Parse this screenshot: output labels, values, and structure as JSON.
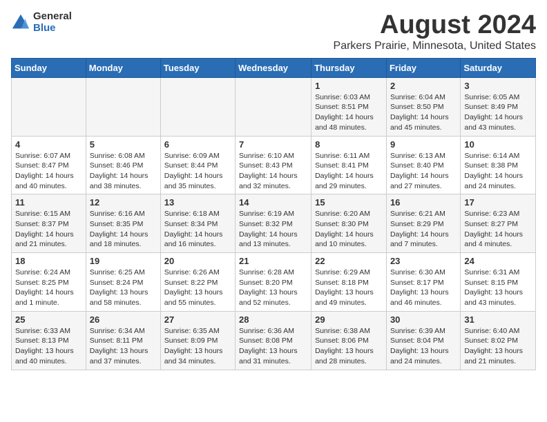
{
  "header": {
    "logo_general": "General",
    "logo_blue": "Blue",
    "month_year": "August 2024",
    "location": "Parkers Prairie, Minnesota, United States"
  },
  "days_of_week": [
    "Sunday",
    "Monday",
    "Tuesday",
    "Wednesday",
    "Thursday",
    "Friday",
    "Saturday"
  ],
  "weeks": [
    [
      {
        "day": "",
        "info": ""
      },
      {
        "day": "",
        "info": ""
      },
      {
        "day": "",
        "info": ""
      },
      {
        "day": "",
        "info": ""
      },
      {
        "day": "1",
        "info": "Sunrise: 6:03 AM\nSunset: 8:51 PM\nDaylight: 14 hours\nand 48 minutes."
      },
      {
        "day": "2",
        "info": "Sunrise: 6:04 AM\nSunset: 8:50 PM\nDaylight: 14 hours\nand 45 minutes."
      },
      {
        "day": "3",
        "info": "Sunrise: 6:05 AM\nSunset: 8:49 PM\nDaylight: 14 hours\nand 43 minutes."
      }
    ],
    [
      {
        "day": "4",
        "info": "Sunrise: 6:07 AM\nSunset: 8:47 PM\nDaylight: 14 hours\nand 40 minutes."
      },
      {
        "day": "5",
        "info": "Sunrise: 6:08 AM\nSunset: 8:46 PM\nDaylight: 14 hours\nand 38 minutes."
      },
      {
        "day": "6",
        "info": "Sunrise: 6:09 AM\nSunset: 8:44 PM\nDaylight: 14 hours\nand 35 minutes."
      },
      {
        "day": "7",
        "info": "Sunrise: 6:10 AM\nSunset: 8:43 PM\nDaylight: 14 hours\nand 32 minutes."
      },
      {
        "day": "8",
        "info": "Sunrise: 6:11 AM\nSunset: 8:41 PM\nDaylight: 14 hours\nand 29 minutes."
      },
      {
        "day": "9",
        "info": "Sunrise: 6:13 AM\nSunset: 8:40 PM\nDaylight: 14 hours\nand 27 minutes."
      },
      {
        "day": "10",
        "info": "Sunrise: 6:14 AM\nSunset: 8:38 PM\nDaylight: 14 hours\nand 24 minutes."
      }
    ],
    [
      {
        "day": "11",
        "info": "Sunrise: 6:15 AM\nSunset: 8:37 PM\nDaylight: 14 hours\nand 21 minutes."
      },
      {
        "day": "12",
        "info": "Sunrise: 6:16 AM\nSunset: 8:35 PM\nDaylight: 14 hours\nand 18 minutes."
      },
      {
        "day": "13",
        "info": "Sunrise: 6:18 AM\nSunset: 8:34 PM\nDaylight: 14 hours\nand 16 minutes."
      },
      {
        "day": "14",
        "info": "Sunrise: 6:19 AM\nSunset: 8:32 PM\nDaylight: 14 hours\nand 13 minutes."
      },
      {
        "day": "15",
        "info": "Sunrise: 6:20 AM\nSunset: 8:30 PM\nDaylight: 14 hours\nand 10 minutes."
      },
      {
        "day": "16",
        "info": "Sunrise: 6:21 AM\nSunset: 8:29 PM\nDaylight: 14 hours\nand 7 minutes."
      },
      {
        "day": "17",
        "info": "Sunrise: 6:23 AM\nSunset: 8:27 PM\nDaylight: 14 hours\nand 4 minutes."
      }
    ],
    [
      {
        "day": "18",
        "info": "Sunrise: 6:24 AM\nSunset: 8:25 PM\nDaylight: 14 hours\nand 1 minute."
      },
      {
        "day": "19",
        "info": "Sunrise: 6:25 AM\nSunset: 8:24 PM\nDaylight: 13 hours\nand 58 minutes."
      },
      {
        "day": "20",
        "info": "Sunrise: 6:26 AM\nSunset: 8:22 PM\nDaylight: 13 hours\nand 55 minutes."
      },
      {
        "day": "21",
        "info": "Sunrise: 6:28 AM\nSunset: 8:20 PM\nDaylight: 13 hours\nand 52 minutes."
      },
      {
        "day": "22",
        "info": "Sunrise: 6:29 AM\nSunset: 8:18 PM\nDaylight: 13 hours\nand 49 minutes."
      },
      {
        "day": "23",
        "info": "Sunrise: 6:30 AM\nSunset: 8:17 PM\nDaylight: 13 hours\nand 46 minutes."
      },
      {
        "day": "24",
        "info": "Sunrise: 6:31 AM\nSunset: 8:15 PM\nDaylight: 13 hours\nand 43 minutes."
      }
    ],
    [
      {
        "day": "25",
        "info": "Sunrise: 6:33 AM\nSunset: 8:13 PM\nDaylight: 13 hours\nand 40 minutes."
      },
      {
        "day": "26",
        "info": "Sunrise: 6:34 AM\nSunset: 8:11 PM\nDaylight: 13 hours\nand 37 minutes."
      },
      {
        "day": "27",
        "info": "Sunrise: 6:35 AM\nSunset: 8:09 PM\nDaylight: 13 hours\nand 34 minutes."
      },
      {
        "day": "28",
        "info": "Sunrise: 6:36 AM\nSunset: 8:08 PM\nDaylight: 13 hours\nand 31 minutes."
      },
      {
        "day": "29",
        "info": "Sunrise: 6:38 AM\nSunset: 8:06 PM\nDaylight: 13 hours\nand 28 minutes."
      },
      {
        "day": "30",
        "info": "Sunrise: 6:39 AM\nSunset: 8:04 PM\nDaylight: 13 hours\nand 24 minutes."
      },
      {
        "day": "31",
        "info": "Sunrise: 6:40 AM\nSunset: 8:02 PM\nDaylight: 13 hours\nand 21 minutes."
      }
    ]
  ]
}
